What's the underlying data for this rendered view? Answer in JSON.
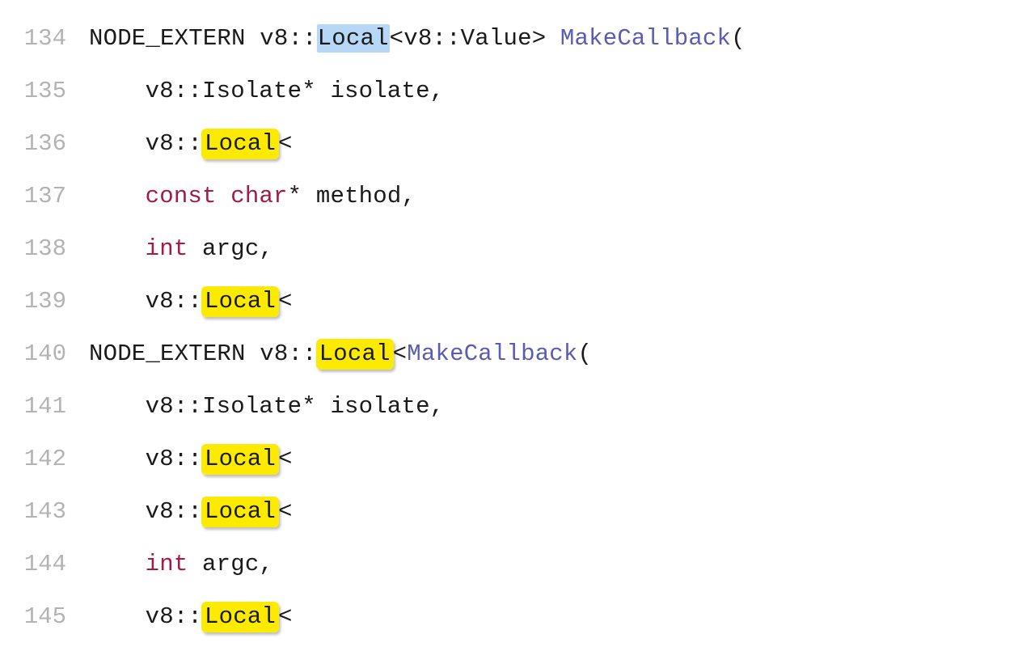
{
  "lines": [
    {
      "num": "134",
      "indent": "a",
      "tokens": [
        {
          "t": "NODE_EXTERN v8::",
          "c": "tok-default"
        },
        {
          "t": "Local",
          "c": "tok-default",
          "sel": true
        },
        {
          "t": "<v8::Value> ",
          "c": "tok-default"
        },
        {
          "t": "MakeCallback",
          "c": "tok-func"
        },
        {
          "t": "(",
          "c": "tok-default"
        }
      ]
    },
    {
      "num": "135",
      "indent": "b",
      "tokens": [
        {
          "t": "v8::Isolate* isolate,",
          "c": "tok-default"
        }
      ]
    },
    {
      "num": "136",
      "indent": "b",
      "tokens": [
        {
          "t": "v8::",
          "c": "tok-default"
        },
        {
          "t": "Local",
          "c": "tok-default",
          "hl": true
        },
        {
          "t": "<",
          "c": "tok-default"
        }
      ]
    },
    {
      "num": "137",
      "indent": "b",
      "tokens": [
        {
          "t": "const",
          "c": "tok-keyword"
        },
        {
          "t": " ",
          "c": "tok-default"
        },
        {
          "t": "char",
          "c": "tok-type"
        },
        {
          "t": "* method,",
          "c": "tok-default"
        }
      ]
    },
    {
      "num": "138",
      "indent": "b",
      "tokens": [
        {
          "t": "int",
          "c": "tok-type"
        },
        {
          "t": " argc,",
          "c": "tok-default"
        }
      ]
    },
    {
      "num": "139",
      "indent": "b",
      "tokens": [
        {
          "t": "v8::",
          "c": "tok-default"
        },
        {
          "t": "Local",
          "c": "tok-default",
          "hl": true
        },
        {
          "t": "<",
          "c": "tok-default"
        }
      ]
    },
    {
      "num": "140",
      "indent": "a",
      "tokens": [
        {
          "t": "NODE_EXTERN v8::",
          "c": "tok-default"
        },
        {
          "t": "Local",
          "c": "tok-default",
          "hl": true
        },
        {
          "t": "<",
          "c": "tok-default"
        },
        {
          "t": "MakeCallback",
          "c": "tok-func"
        },
        {
          "t": "(",
          "c": "tok-default"
        }
      ]
    },
    {
      "num": "141",
      "indent": "b",
      "tokens": [
        {
          "t": "v8::Isolate* isolate,",
          "c": "tok-default"
        }
      ]
    },
    {
      "num": "142",
      "indent": "b",
      "tokens": [
        {
          "t": "v8::",
          "c": "tok-default"
        },
        {
          "t": "Local",
          "c": "tok-default",
          "hl": true
        },
        {
          "t": "<",
          "c": "tok-default"
        }
      ]
    },
    {
      "num": "143",
      "indent": "b",
      "tokens": [
        {
          "t": "v8::",
          "c": "tok-default"
        },
        {
          "t": "Local",
          "c": "tok-default",
          "hl": true
        },
        {
          "t": "<",
          "c": "tok-default"
        }
      ]
    },
    {
      "num": "144",
      "indent": "b",
      "tokens": [
        {
          "t": "int",
          "c": "tok-type"
        },
        {
          "t": " argc,",
          "c": "tok-default"
        }
      ]
    },
    {
      "num": "145",
      "indent": "b",
      "tokens": [
        {
          "t": "v8::",
          "c": "tok-default"
        },
        {
          "t": "Local",
          "c": "tok-default",
          "hl": true
        },
        {
          "t": "<",
          "c": "tok-default"
        }
      ]
    }
  ]
}
